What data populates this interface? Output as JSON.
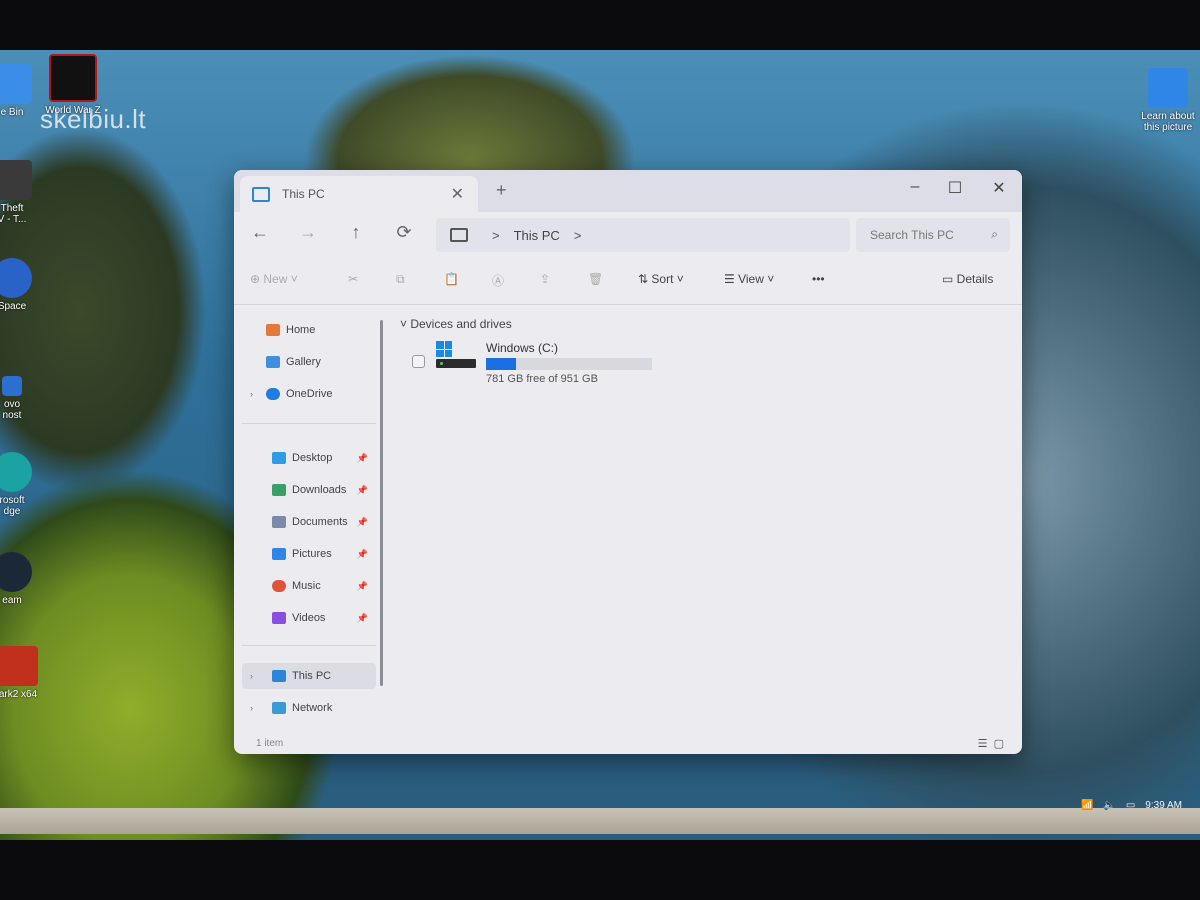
{
  "watermark": "skelbiu.lt",
  "desktop": {
    "icons": [
      {
        "label": "e Bin",
        "color": "#3b8ee8"
      },
      {
        "label": "World War Z",
        "color": "#b0161a"
      },
      {
        "label": "Theft\nV - T...",
        "color": "#3a3a3a"
      },
      {
        "label": "Space",
        "color": "#2a63c8"
      },
      {
        "label": "ovo\nnost",
        "color": "#2b6fd0"
      },
      {
        "label": "rosoft\ndge",
        "color": "#1aa3a0"
      },
      {
        "label": "eam",
        "color": "#1b2838"
      },
      {
        "label": "ark2 x64",
        "color": "#c0301c"
      },
      {
        "label": "Learn about\nthis picture",
        "color": "#2f86e6"
      }
    ],
    "clock": "9:39 AM"
  },
  "window": {
    "tab_title": "This PC",
    "new_tab": "+",
    "controls": {
      "minimize": "–",
      "maximize": "☐",
      "close": "✕"
    },
    "nav": {
      "back": "←",
      "forward": "→",
      "up": "↑",
      "refresh": "⟳"
    },
    "address": {
      "location": "This PC",
      "sep": ">",
      "trail": ">"
    },
    "search": {
      "placeholder": "Search This PC"
    },
    "toolbar": {
      "new": "New",
      "sort": "Sort",
      "view": "View",
      "more": "•••",
      "details": "Details"
    },
    "sidebar": {
      "home": "Home",
      "gallery": "Gallery",
      "onedrive": "OneDrive",
      "desktop": "Desktop",
      "downloads": "Downloads",
      "documents": "Documents",
      "pictures": "Pictures",
      "music": "Music",
      "videos": "Videos",
      "this_pc": "This PC",
      "network": "Network"
    },
    "content": {
      "group_title": "Devices and drives",
      "drive": {
        "name": "Windows (C:)",
        "free_text": "781 GB free of 951 GB",
        "used_fraction": 0.18
      }
    },
    "status": {
      "item_count": "1 item"
    }
  }
}
